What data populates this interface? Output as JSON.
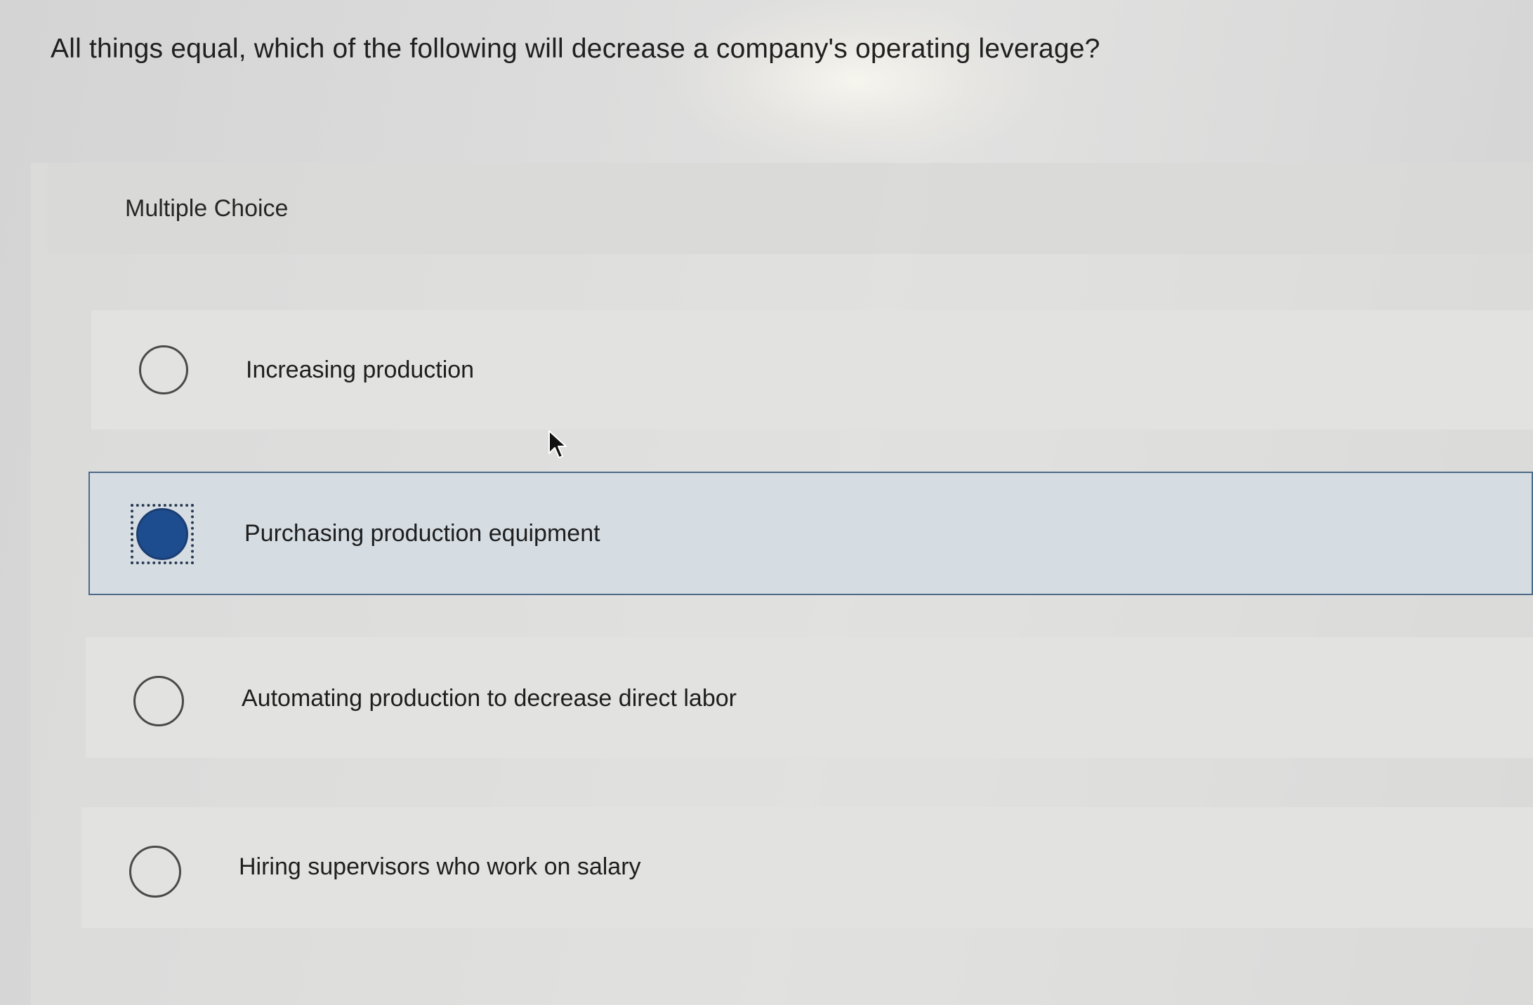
{
  "question": {
    "text": "All things equal, which of the following will decrease a company's operating leverage?"
  },
  "multiple_choice": {
    "label": "Multiple Choice",
    "selected_index": 1,
    "options": [
      {
        "label": "Increasing production",
        "selected": false
      },
      {
        "label": "Purchasing production equipment",
        "selected": true
      },
      {
        "label": "Automating production to decrease direct labor",
        "selected": false
      },
      {
        "label": "Hiring supervisors who work on salary",
        "selected": false
      }
    ]
  },
  "colors": {
    "selected_fill": "#1d4d8f",
    "selected_row_bg": "#d5dde3",
    "selected_row_border": "#4e6a88",
    "radio_border": "#4a4a4a"
  },
  "icons": {
    "radio_unselected": "radio-empty-icon",
    "radio_selected": "radio-filled-icon",
    "cursor": "mouse-pointer-icon"
  }
}
